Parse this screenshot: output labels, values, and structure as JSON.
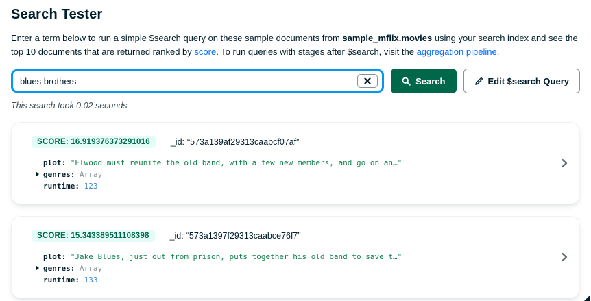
{
  "page": {
    "title": "Search Tester",
    "description": {
      "part1": "Enter a term below to run a simple $search query on these sample documents from ",
      "bold1": "sample_mflix.movies",
      "part2": " using your search index and see the top 10 documents that are returned ranked by ",
      "link_score": "score",
      "part3": ". To run queries with stages after $search, visit the ",
      "link_aggregation": "aggregation pipeline",
      "part4": "."
    }
  },
  "search": {
    "value": "blues brothers",
    "search_button_label": "Search",
    "edit_button_label": "Edit $search Query",
    "timing": "This search took 0.02 seconds"
  },
  "icons": {
    "search": "magnifying-glass",
    "clear": "x",
    "edit": "pencil",
    "expand": "caret-right",
    "open": "chevron-right"
  },
  "colors": {
    "focus_blue": "#0498EC",
    "primary_green": "#00684A",
    "badge_bg": "#E3FCF7",
    "badge_text": "#00684A",
    "link_blue": "#016BF8",
    "code_string_green": "#12824D",
    "code_number_blue": "#3E8BD0",
    "code_array_gray": "#889397",
    "heading_navy": "#001E2B"
  },
  "results": [
    {
      "score": "SCORE: 16.919376373291016",
      "id_key": "_id:",
      "id_value": "“573a139af29313caabcf07af”",
      "fields": [
        {
          "key": "plot:",
          "value": "\"Elwood must reunite the old band, with a few new members, and go on an…\"",
          "type": "string"
        },
        {
          "key": "genres:",
          "value": "Array",
          "type": "array"
        },
        {
          "key": "runtime:",
          "value": "123",
          "type": "number"
        }
      ]
    },
    {
      "score": "SCORE: 15.343389511108398",
      "id_key": "_id:",
      "id_value": "“573a1397f29313caabce76f7”",
      "fields": [
        {
          "key": "plot:",
          "value": "\"Jake Blues, just out from prison, puts together his old band to save t…\"",
          "type": "string"
        },
        {
          "key": "genres:",
          "value": "Array",
          "type": "array"
        },
        {
          "key": "runtime:",
          "value": "133",
          "type": "number"
        }
      ]
    }
  ]
}
